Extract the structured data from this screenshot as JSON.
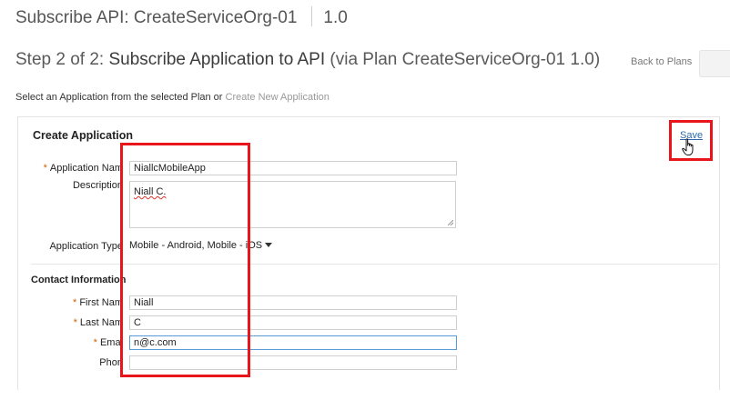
{
  "header": {
    "title": "Subscribe API: CreateServiceOrg-01",
    "version": "1.0"
  },
  "step": {
    "prefix": "Step 2 of 2:",
    "title": "Subscribe Application to API",
    "plan": "(via Plan CreateServiceOrg-01 1.0)",
    "back_label": "Back to Plans"
  },
  "intro": {
    "text": "Select an Application from the selected Plan or",
    "link": "Create New Application"
  },
  "form": {
    "title": "Create Application",
    "save_label": "Save",
    "application_name": {
      "label": "Application Nam",
      "value": "NiallcMobileApp"
    },
    "description": {
      "label": "Description",
      "value": "Niall C."
    },
    "application_type": {
      "label": "Application Type",
      "value": "Mobile - Android, Mobile - iOS"
    },
    "contact_section": "Contact Information",
    "first_name": {
      "label": "First Nam",
      "value": "Niall"
    },
    "last_name": {
      "label": "Last Nam",
      "value": "C"
    },
    "email": {
      "label": "Emai",
      "value": "n@c.com"
    },
    "phone": {
      "label": "Phon",
      "value": ""
    }
  },
  "colors": {
    "highlight": "#e8161b",
    "link": "#2a6ab0",
    "required": "#d06000"
  }
}
